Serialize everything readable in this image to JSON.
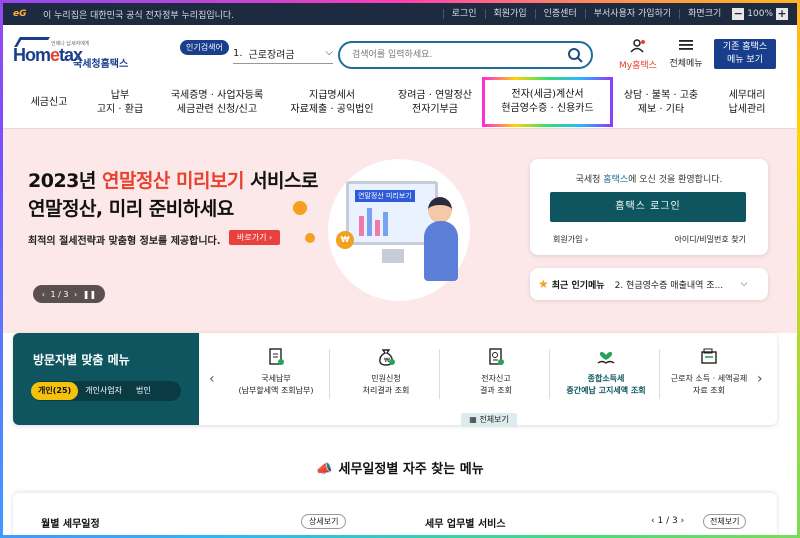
{
  "topbar": {
    "gov_notice": "이 누리집은 대한민국 공식 전자정부 누리집입니다.",
    "links": [
      "로그인",
      "회원가입",
      "인증센터",
      "부서사용자 가입하기",
      "화면크기"
    ],
    "zoom": "100%",
    "zoom_minus": "−",
    "zoom_plus": "+"
  },
  "header": {
    "logo_text_home": "Hom",
    "logo_text_e": "e",
    "logo_text_tax": "tax",
    "logo_sub": "국세청홈택스",
    "logo_tiny": "언제나 납세자에게",
    "popular_badge": "인기검색어",
    "popular_num": "1.",
    "popular_term": "근로장려금",
    "search_placeholder": "검색어를 입력하세요.",
    "my_label": "My홈택스",
    "menu_label": "전체메뉴",
    "old_line1": "기존 홈택스",
    "old_line2": "메뉴 보기"
  },
  "nav": [
    {
      "l1": "세금신고",
      "l2": ""
    },
    {
      "l1": "납부",
      "l2": "고지 · 환급"
    },
    {
      "l1": "국세증명 · 사업자등록",
      "l2": "세금관련 신청/신고"
    },
    {
      "l1": "지급명세서",
      "l2": "자료제출 · 공익법인"
    },
    {
      "l1": "장려금 · 연말정산",
      "l2": "전자기부금"
    },
    {
      "l1": "전자(세금)계산서",
      "l2": "현금영수증 · 신용카드"
    },
    {
      "l1": "상담 · 불복 · 고충",
      "l2": "제보 · 기타"
    },
    {
      "l1": "세무대리",
      "l2": "납세관리"
    }
  ],
  "hero": {
    "title_a": "2023년 ",
    "title_red": "연말정산 미리보기",
    "title_b": " 서비스로",
    "title_line2": "연말정산, 미리 준비하세요",
    "desc": "최적의 절세전략과 맞춤형 정보를 제공합니다.",
    "button": "바로가기",
    "pager": "1 / 3",
    "monitor_title": "연말정산 미리보기",
    "coin_symbol": "₩"
  },
  "login": {
    "welcome_a": "국세청 ",
    "welcome_brand": "홈택스",
    "welcome_b": "에 오신 것을 환영합니다.",
    "login_button": "홈택스 로그인",
    "join": "회원가입",
    "find": "아이디/비밀번호 찾기"
  },
  "popular_menu": {
    "label": "최근 인기메뉴",
    "item": "2. 현금영수증 매출내역 조..."
  },
  "visitor": {
    "title": "방문자별 맞춤 메뉴",
    "segments": [
      "개인(25)",
      "개인사업자",
      "법인"
    ],
    "items": [
      {
        "l1": "국세납부",
        "l2": "(납부할세액 조회납부)"
      },
      {
        "l1": "민원신청",
        "l2": "처리결과 조회"
      },
      {
        "l1": "전자신고",
        "l2": "결과 조회"
      },
      {
        "l1": "종합소득세",
        "l2": "중간예납 고지세액 조회"
      },
      {
        "l1": "근로자 소득 · 세액공제",
        "l2": "자료 조회"
      }
    ],
    "view_all": "전체보기"
  },
  "schedule": {
    "title": "세무일정별 자주 찾는 메뉴",
    "monthly": "월별 세무일정",
    "more": "상세보기",
    "services": "세무 업무별 서비스",
    "pager": "1 / 3",
    "all": "전체보기"
  },
  "colors": {
    "navy": "#183e8c",
    "teal": "#0f5560",
    "accent_red": "#e8412c",
    "hero_bg": "#fce8e8"
  }
}
